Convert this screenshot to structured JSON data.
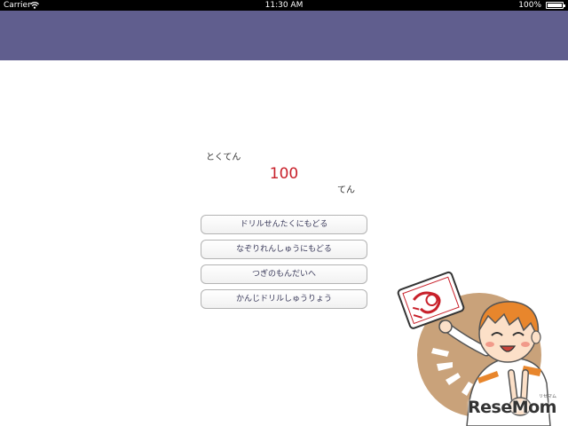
{
  "status_bar": {
    "carrier": "Carrier",
    "time": "11:30 AM",
    "battery": "100%",
    "wifi_icon": "wifi-icon",
    "battery_icon": "battery-icon"
  },
  "nav_bar": {
    "color": "#605e8e"
  },
  "score": {
    "label": "とくてん",
    "value": "100",
    "unit": "てん",
    "value_color": "#c8202a"
  },
  "menu": {
    "items": [
      {
        "label": "ドリルせんたくにもどる"
      },
      {
        "label": "なぞりれんしゅうにもどる"
      },
      {
        "label": "つぎのもんだいへ"
      },
      {
        "label": "かんじドリルしゅうりょう"
      }
    ]
  },
  "watermark": {
    "logo": "ReseMom",
    "ruby": "リセマム"
  },
  "illustration": {
    "name": "mascot-holding-test-paper",
    "icon": "mascot-illustration"
  }
}
